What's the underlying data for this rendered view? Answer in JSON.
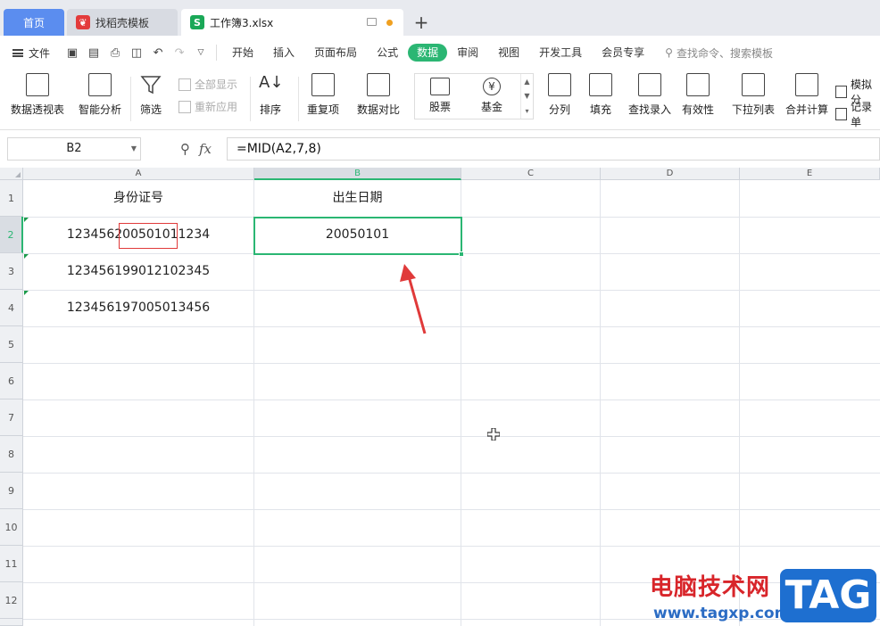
{
  "tabs": {
    "home": "首页",
    "template": "找稻壳模板",
    "doc": "工作簿3.xlsx",
    "template_icon": "daoke-logo-icon",
    "doc_icon": "wps-sheet-icon",
    "doc_icon_letter": "S"
  },
  "menu": {
    "file": "文件",
    "items": [
      "开始",
      "插入",
      "页面布局",
      "公式",
      "数据",
      "审阅",
      "视图",
      "开发工具",
      "会员专享"
    ],
    "active": "数据",
    "search_placeholder": "查找命令、搜索模板"
  },
  "ribbon": {
    "pivot": "数据透视表",
    "smart": "智能分析",
    "filter": "筛选",
    "show_all": "全部显示",
    "reapply": "重新应用",
    "sort": "排序",
    "duplicates": "重复项",
    "compare": "数据对比",
    "stocks": "股票",
    "funds": "基金",
    "split": "分列",
    "fill": "填充",
    "lookup": "查找录入",
    "validity": "有效性",
    "dropdown": "下拉列表",
    "consolidate": "合并计算",
    "simulate": "模拟分",
    "record": "记录单"
  },
  "formula_bar": {
    "name_box": "B2",
    "fx": "fx",
    "formula": "=MID(A2,7,8)"
  },
  "grid": {
    "columns": [
      "A",
      "B",
      "C",
      "D",
      "E"
    ],
    "rows": [
      "1",
      "2",
      "3",
      "4",
      "5",
      "6",
      "7",
      "8",
      "9",
      "10",
      "11",
      "12"
    ],
    "cells": {
      "A1": "身份证号",
      "B1": "出生日期",
      "A2": "123456200501011234",
      "B2": "20050101",
      "A3": "123456199012102345",
      "A4": "123456197005013456"
    },
    "selected_cell": "B2",
    "highlight_color": "#2bb673",
    "annotation_color": "#e03a3a"
  },
  "watermark": {
    "cn": "电脑技术网",
    "url": "www.tagxp.com",
    "tag": "TAG"
  }
}
